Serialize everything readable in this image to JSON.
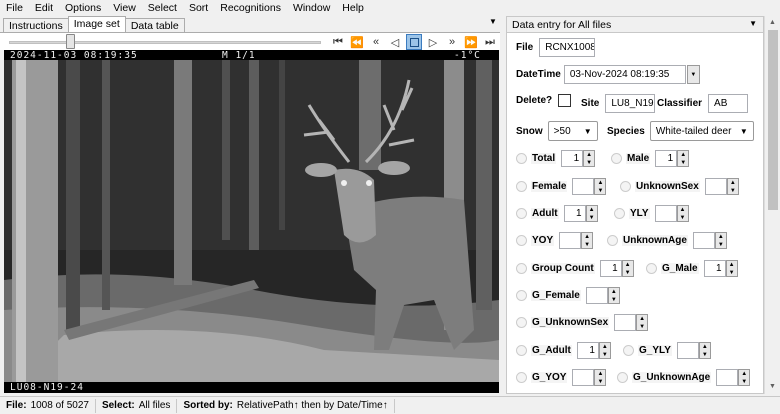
{
  "menu": [
    "File",
    "Edit",
    "Options",
    "View",
    "Select",
    "Sort",
    "Recognitions",
    "Window",
    "Help"
  ],
  "tabs": [
    "Instructions",
    "Image set",
    "Data table"
  ],
  "image": {
    "top_left": "2024-11-03 08:19:35",
    "top_mid": "M 1/1",
    "top_right": "-1°C",
    "bottom_left": "LU08-N19-24"
  },
  "panel": {
    "title": "Data entry for All files",
    "file_label": "File",
    "file_value": "RCNX1008...",
    "datetime_label": "DateTime",
    "datetime_value": "03-Nov-2024 08:19:35",
    "delete_label": "Delete?",
    "site_label": "Site",
    "site_value": "LU8_N19",
    "classifier_label": "Classifier",
    "classifier_value": "AB",
    "snow_label": "Snow",
    "snow_value": ">50",
    "species_label": "Species",
    "species_value": "White-tailed deer",
    "counters": [
      {
        "label": "Total",
        "value": "1"
      },
      {
        "label": "Male",
        "value": "1"
      },
      {
        "label": "Female",
        "value": ""
      },
      {
        "label": "UnknownSex",
        "value": ""
      },
      {
        "label": "Adult",
        "value": "1"
      },
      {
        "label": "YLY",
        "value": ""
      },
      {
        "label": "YOY",
        "value": ""
      },
      {
        "label": "UnknownAge",
        "value": ""
      },
      {
        "label": "Group Count",
        "value": "1"
      },
      {
        "label": "G_Male",
        "value": "1"
      },
      {
        "label": "G_Female",
        "value": ""
      },
      {
        "label": "G_UnknownSex",
        "value": ""
      },
      {
        "label": "G_Adult",
        "value": "1"
      },
      {
        "label": "G_YLY",
        "value": ""
      },
      {
        "label": "G_YOY",
        "value": ""
      },
      {
        "label": "G_UnknownAge",
        "value": ""
      }
    ]
  },
  "status": {
    "file_label": "File:",
    "file_value": "1008 of 5027",
    "select_label": "Select:",
    "select_value": "All files",
    "sort_label": "Sorted by:",
    "sort_value": "RelativePath↑ then by Date/Time↑"
  }
}
